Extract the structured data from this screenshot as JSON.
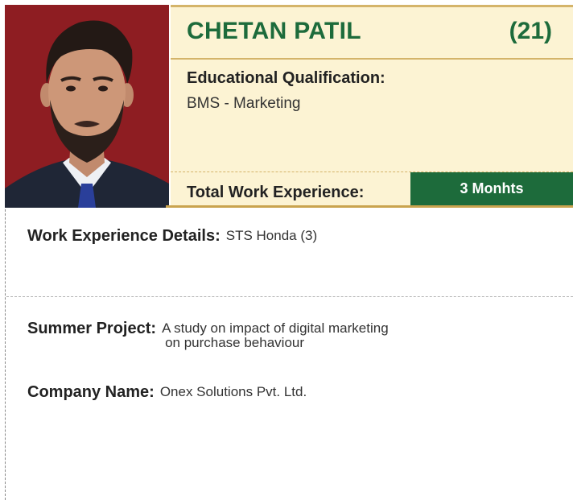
{
  "profile": {
    "name": "CHETAN PATIL",
    "roll": "(21)",
    "education_label": "Educational Qualification:",
    "education_value": "BMS - Marketing",
    "experience_label": "Total Work Experience:",
    "experience_value": "3 Monhts"
  },
  "details": {
    "work_label": "Work Experience Details:",
    "work_value": "STS Honda (3)",
    "project_label": "Summer Project:",
    "project_value_line1": "A study on impact of digital marketing",
    "project_value_line2": "on purchase behaviour",
    "company_label": "Company Name:",
    "company_value": "Onex Solutions Pvt. Ltd."
  },
  "colors": {
    "accent_green": "#1d6b3b",
    "gold": "#d4b46a",
    "card_bg": "#fcf3d3",
    "photo_bg": "#8e1d22"
  }
}
